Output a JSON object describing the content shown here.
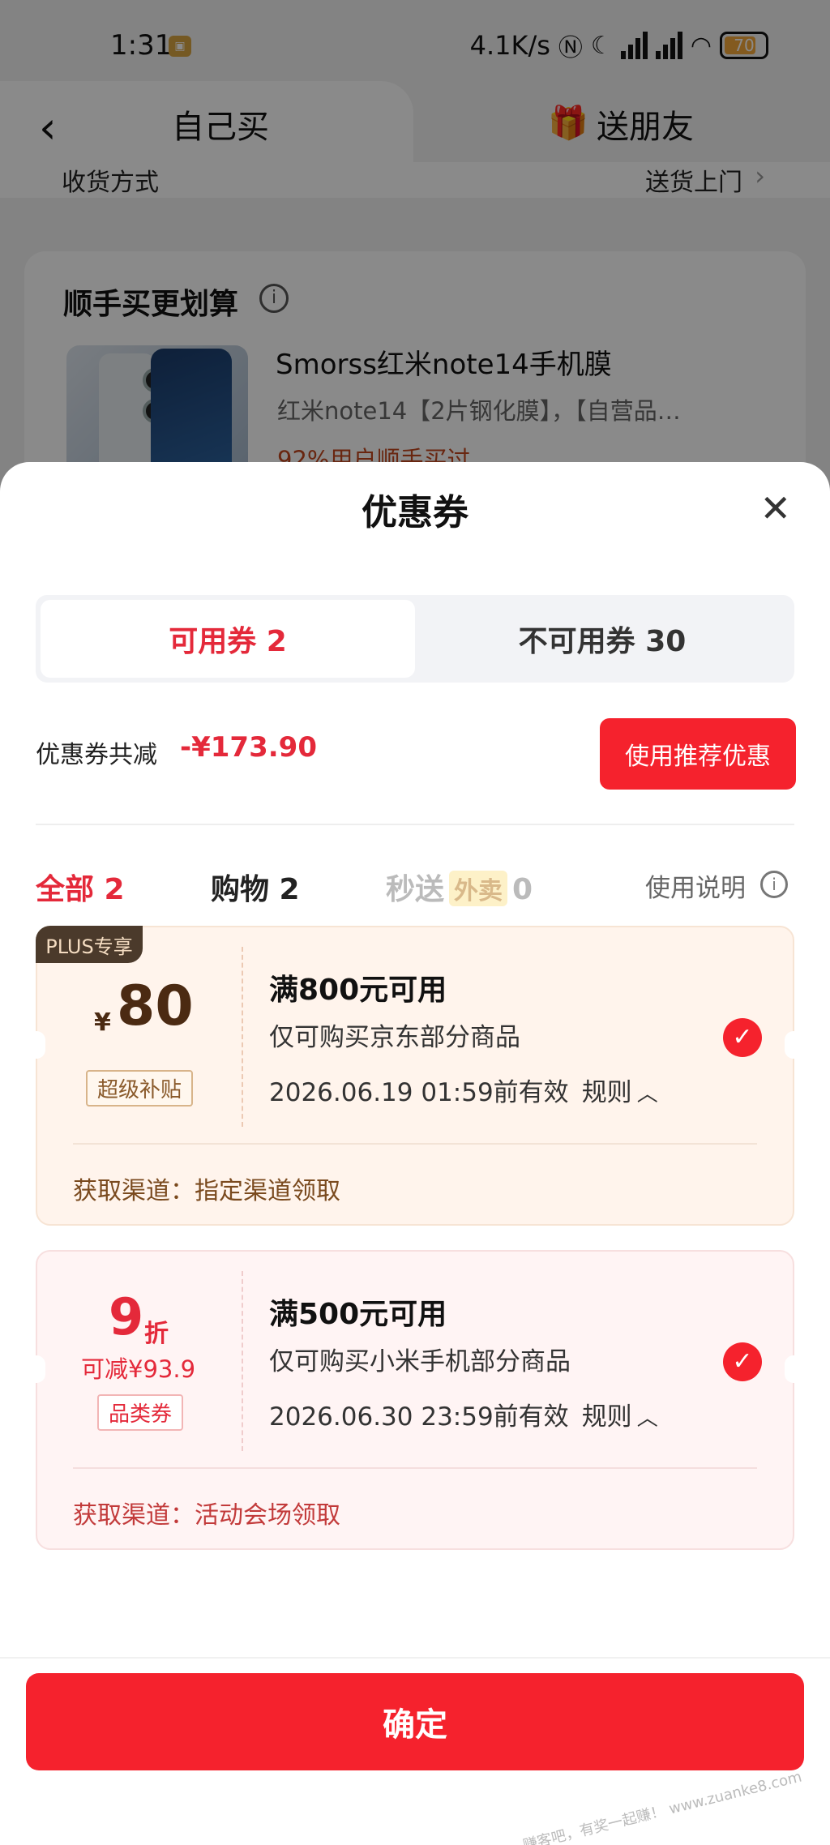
{
  "status_bar": {
    "time": "1:31",
    "network_speed": "4.1K/s",
    "battery": "70"
  },
  "top_nav": {
    "tab_self": "自己买",
    "tab_gift": "送朋友"
  },
  "background": {
    "delivery_label": "收货方式",
    "delivery_value": "送货上门",
    "bundle_title": "顺手买更划算",
    "product_title": "Smorss红米note14手机膜",
    "product_subtitle": "红米note14【2片钢化膜】，【自营品…",
    "product_stat": "92%用户顺手买过"
  },
  "sheet": {
    "title": "优惠券",
    "tabs": [
      {
        "label": "可用券 2"
      },
      {
        "label": "不可用券 30"
      }
    ],
    "total_label": "优惠券共减",
    "total_amount": "-¥173.90",
    "recommend_button": "使用推荐优惠",
    "filters": {
      "all": "全部 2",
      "shopping": "购物 2",
      "fast": "秒送",
      "fast_tag": "外卖",
      "fast_count": "0",
      "help": "使用说明"
    },
    "coupons": [
      {
        "tag": "PLUS专享",
        "currency": "¥",
        "amount": "80",
        "badge": "超级补贴",
        "title": "满800元可用",
        "scope": "仅可购买京东部分商品",
        "expiry": "2026.06.19 01:59前有效",
        "rule": "规则",
        "source": "获取渠道：指定渠道领取",
        "selected": true
      },
      {
        "discount": "9",
        "discount_unit": "折",
        "save": "可减¥93.9",
        "badge": "品类券",
        "title": "满500元可用",
        "scope": "仅可购买小米手机部分商品",
        "expiry": "2026.06.30 23:59前有效",
        "rule": "规则",
        "source": "获取渠道：活动会场领取",
        "selected": true
      }
    ],
    "confirm_button": "确定"
  },
  "watermark": "赚客吧，有奖一起赚！ www.zuanke8.com",
  "colors": {
    "accent_red": "#f5222d",
    "price_red": "#e4293a",
    "plus_brown": "#4b3a2b"
  }
}
